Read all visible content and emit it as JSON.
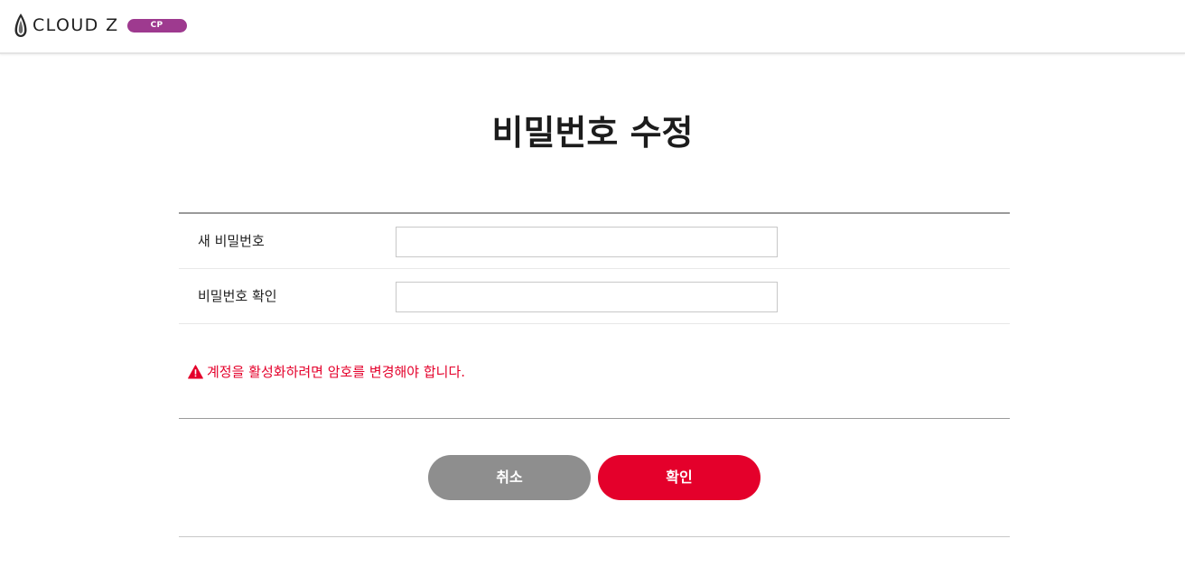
{
  "header": {
    "logo_text": "CLOUD Z",
    "badge": "CP"
  },
  "page": {
    "title": "비밀번호 수정"
  },
  "form": {
    "rows": [
      {
        "label": "새 비밀번호",
        "value": "",
        "placeholder": ""
      },
      {
        "label": "비밀번호 확인",
        "value": "",
        "placeholder": ""
      }
    ]
  },
  "warning": {
    "icon": "warning-triangle-icon",
    "text": "계정을 활성화하려면 암호를 변경해야 합니다."
  },
  "buttons": {
    "cancel_label": "취소",
    "confirm_label": "확인"
  },
  "colors": {
    "badge": "#9e3a8f",
    "warning": "#e4002b",
    "cancel_bg": "#8e8e8e",
    "confirm_bg": "#e4002b"
  }
}
